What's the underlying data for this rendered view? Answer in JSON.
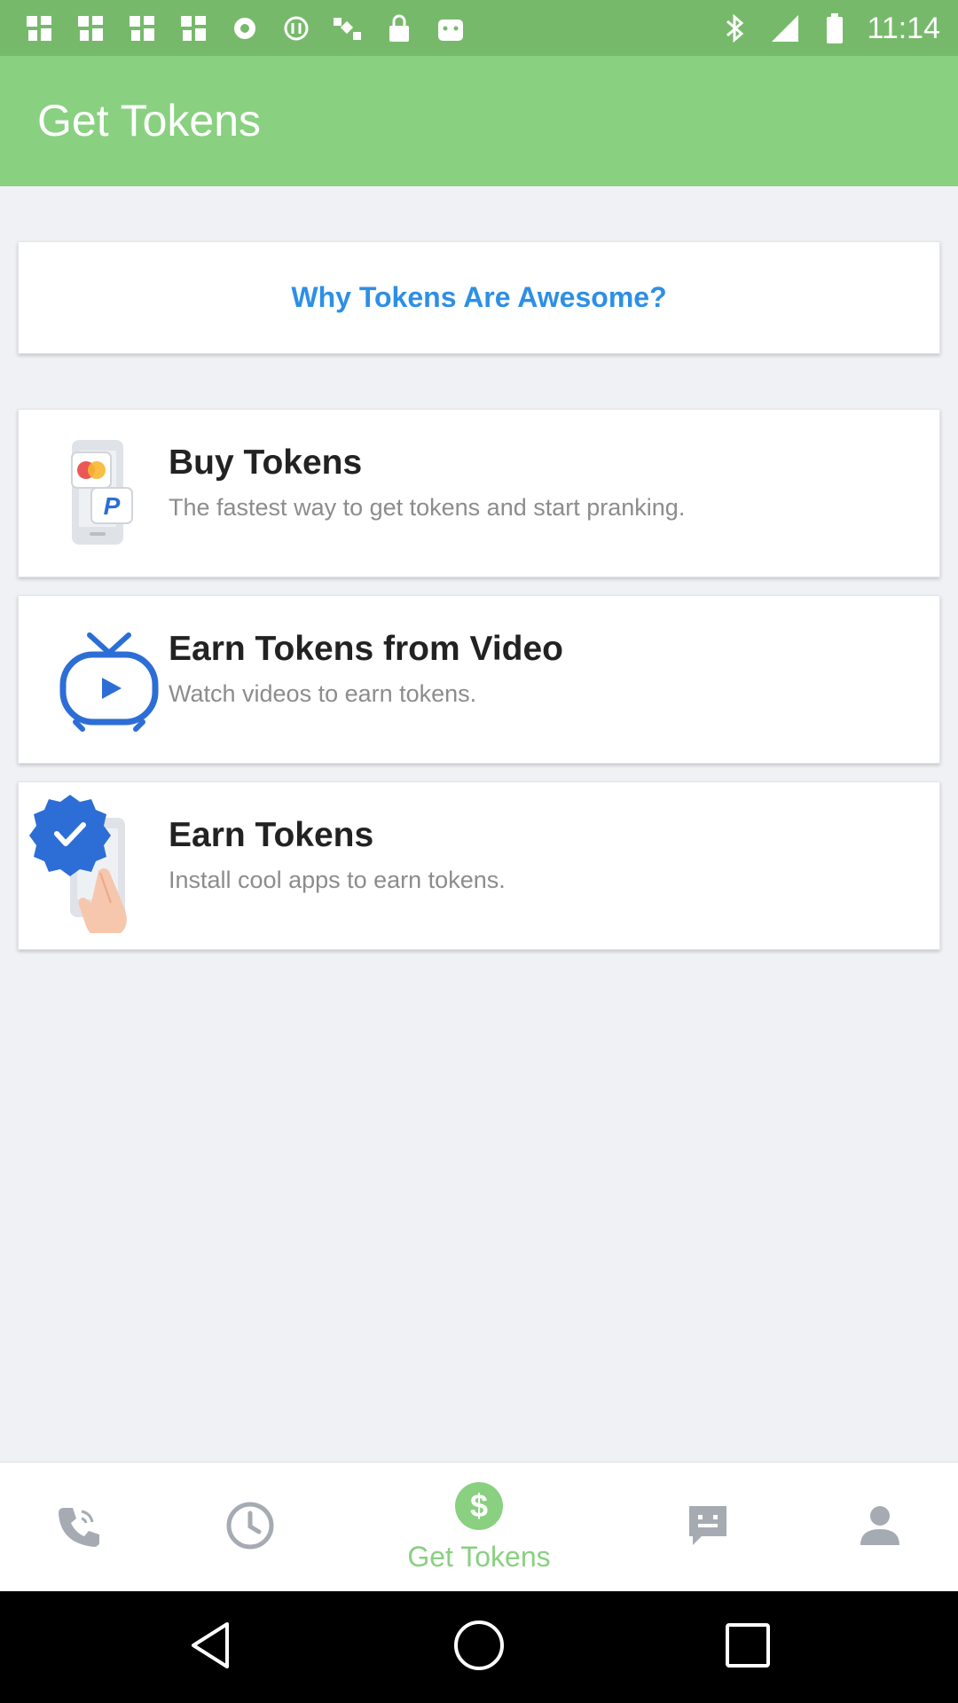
{
  "status_bar": {
    "time": "11:14",
    "icons": [
      "fan-notification-icon",
      "fan-notification-icon",
      "fan-notification-icon",
      "fan-notification-icon",
      "record-icon",
      "blocked-icon",
      "satellite-icon",
      "lock-icon",
      "android-icon",
      "bluetooth-icon",
      "signal-icon",
      "battery-icon"
    ]
  },
  "app_bar": {
    "title": "Get Tokens"
  },
  "why_card": {
    "label": "Why Tokens Are Awesome?"
  },
  "items": [
    {
      "title": "Buy Tokens",
      "description": "The fastest way to get tokens and start pranking.",
      "icon": "payment-phone-icon"
    },
    {
      "title": "Earn Tokens from Video",
      "description": "Watch videos to earn tokens.",
      "icon": "tv-play-icon"
    },
    {
      "title": "Earn Tokens",
      "description": "Install cool apps to earn tokens.",
      "icon": "verified-tap-icon"
    }
  ],
  "bottom_nav": {
    "items": [
      {
        "icon": "phone-icon"
      },
      {
        "icon": "clock-icon"
      },
      {
        "icon": "dollar-icon",
        "label": "Get Tokens",
        "active": true
      },
      {
        "icon": "chat-icon"
      },
      {
        "icon": "person-icon"
      }
    ]
  },
  "colors": {
    "status_bar": "#77b96b",
    "app_bar": "#89d081",
    "accent_blue": "#2d8fe6",
    "nav_active": "#89d081",
    "nav_inactive": "#a6abb3"
  }
}
